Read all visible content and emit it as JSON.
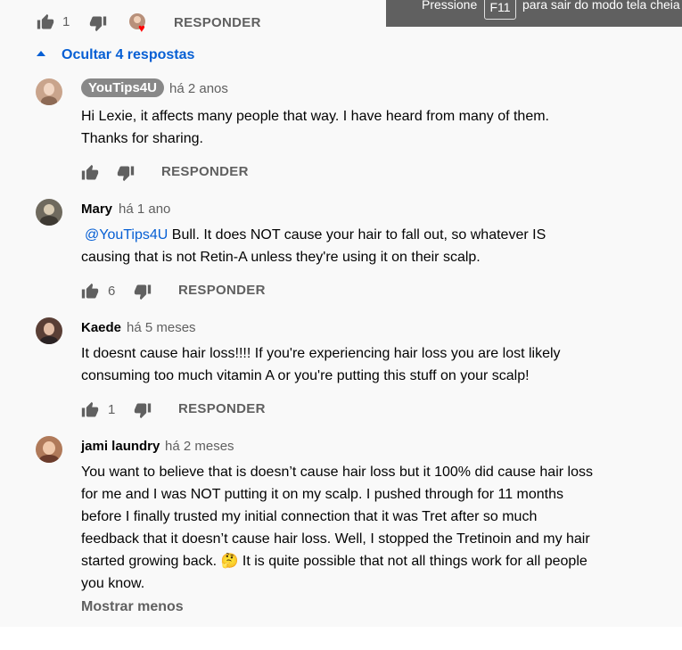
{
  "top_actions": {
    "like_count": "1",
    "reply_label": "RESPONDER"
  },
  "toast": {
    "prefix": "Pressione",
    "key": "F11",
    "suffix": "para sair do modo tela cheia"
  },
  "replies_toggle": {
    "label": "Ocultar 4 respostas"
  },
  "comments": [
    {
      "author": "YouTips4U",
      "time": "há 2 anos",
      "lines": [
        "Hi Lexie, it affects many people that way. I have heard from many of them.",
        "Thanks for sharing."
      ],
      "like_count": "",
      "reply_label": "RESPONDER"
    },
    {
      "author": "Mary",
      "time": "há 1 ano",
      "mention": "@YouTips4U",
      "lines": [
        " Bull.  It does NOT cause your hair to fall out, so whatever IS",
        "causing that is not Retin-A unless they're using it on their scalp."
      ],
      "like_count": "6",
      "reply_label": "RESPONDER"
    },
    {
      "author": "Kaede",
      "time": "há 5 meses",
      "lines": [
        "It doesnt cause hair loss!!!! If you're experiencing hair loss you are lost likely",
        "consuming too much vitamin A or you're putting this stuff on your scalp!"
      ],
      "like_count": "1",
      "reply_label": "RESPONDER"
    },
    {
      "author": "jami laundry",
      "time": "há 2 meses",
      "lines": [
        "You want to believe that is doesn’t cause hair loss but it 100% did cause hair loss",
        "for me and I was NOT putting it on my scalp. I pushed through for 11 months",
        "before I finally trusted my initial connection that it was Tret after so much",
        "feedback that it doesn’t cause hair loss. Well, I stopped the Tretinoin and my hair",
        "started growing back.",
        " It is quite possible that not all things work for all people",
        "you know."
      ],
      "emoji": "🤔",
      "show_less": "Mostrar menos"
    }
  ],
  "colors": {
    "link": "#065fd4",
    "muted": "#606060",
    "heart": "#ff0000",
    "panel": "#f9f9f9"
  }
}
